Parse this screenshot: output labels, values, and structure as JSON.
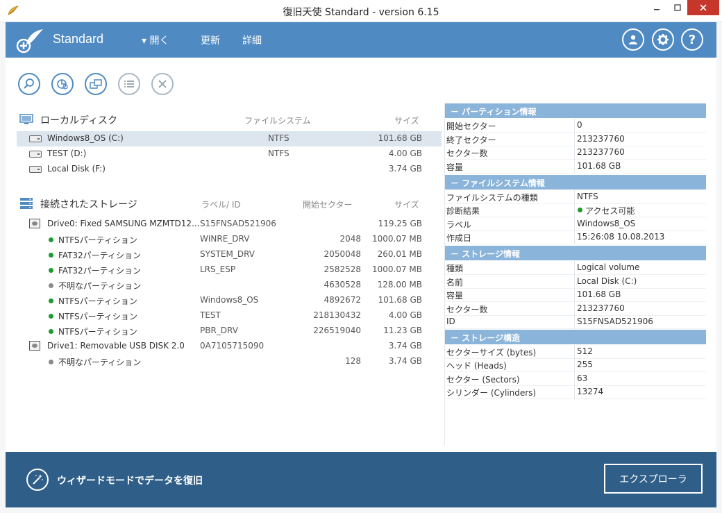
{
  "window": {
    "title": "復旧天使 Standard - version 6.15",
    "min_icon": "minimize-icon",
    "max_icon": "maximize-icon",
    "close_icon": "close-icon"
  },
  "header": {
    "brand": "Standard",
    "menu_open": "▾ 開く",
    "menu_refresh": "更新",
    "menu_detail": "詳細",
    "icons": [
      "user-icon",
      "gear-icon",
      "help-icon"
    ],
    "accent": "#4f8ac3"
  },
  "toolbar": {
    "icons": [
      "search-icon",
      "pie-chart-icon",
      "file-copy-icon",
      "list-icon",
      "close-icon"
    ]
  },
  "local": {
    "title": "ローカルディスク",
    "col_fs": "ファイルシステム",
    "col_size": "サイズ",
    "rows": [
      {
        "name": "Windows8_OS (C:)",
        "fs": "NTFS",
        "size": "101.68 GB"
      },
      {
        "name": "TEST (D:)",
        "fs": "NTFS",
        "size": "4.00 GB"
      },
      {
        "name": "Local Disk (F:)",
        "fs": "",
        "size": "3.74 GB"
      }
    ]
  },
  "storage": {
    "title": "接続されたストレージ",
    "col_label": "ラベル/ ID",
    "col_start": "開始セクター",
    "col_size": "サイズ",
    "rows": [
      {
        "type": "drive",
        "name": "Drive0: Fixed SAMSUNG MZMTD12...",
        "label": "S15FNSAD521906",
        "start": "",
        "size": "119.25 GB"
      },
      {
        "type": "part",
        "status": "green",
        "name": "NTFSパーティション",
        "label": "WINRE_DRV",
        "start": "2048",
        "size": "1000.07 MB"
      },
      {
        "type": "part",
        "status": "green",
        "name": "FAT32パーティション",
        "label": "SYSTEM_DRV",
        "start": "2050048",
        "size": "260.01 MB"
      },
      {
        "type": "part",
        "status": "green",
        "name": "FAT32パーティション",
        "label": "LRS_ESP",
        "start": "2582528",
        "size": "1000.07 MB"
      },
      {
        "type": "part",
        "status": "gray",
        "name": "不明なパーティション",
        "label": "",
        "start": "4630528",
        "size": "128.00 MB"
      },
      {
        "type": "part",
        "status": "green",
        "name": "NTFSパーティション",
        "label": "Windows8_OS",
        "start": "4892672",
        "size": "101.68 GB"
      },
      {
        "type": "part",
        "status": "green",
        "name": "NTFSパーティション",
        "label": "TEST",
        "start": "218130432",
        "size": "4.00 GB"
      },
      {
        "type": "part",
        "status": "green",
        "name": "NTFSパーティション",
        "label": "PBR_DRV",
        "start": "226519040",
        "size": "11.23 GB"
      },
      {
        "type": "drive",
        "name": "Drive1: Removable USB DISK 2.0",
        "label": "0A7105715090",
        "start": "",
        "size": "3.74 GB"
      },
      {
        "type": "part",
        "status": "gray",
        "name": "不明なパーティション",
        "label": "",
        "start": "128",
        "size": "3.74 GB"
      }
    ],
    "status_colors": {
      "green": "#1e9a2e",
      "gray": "#8a8a8a"
    }
  },
  "info": {
    "sections": [
      {
        "title": "－ パーティション情報",
        "rows": [
          {
            "k": "開始セクター",
            "v": "0"
          },
          {
            "k": "終了セクター",
            "v": "213237760"
          },
          {
            "k": "セクター数",
            "v": "213237760"
          },
          {
            "k": "容量",
            "v": "101.68 GB"
          }
        ]
      },
      {
        "title": "－ ファイルシステム情報",
        "rows": [
          {
            "k": "ファイルシステムの種類",
            "v": "NTFS"
          },
          {
            "k": "診断結果",
            "v": "アクセス可能",
            "dot": true
          },
          {
            "k": "ラベル",
            "v": "Windows8_OS"
          },
          {
            "k": "作成日",
            "v": "15:26:08 10.08.2013"
          }
        ]
      },
      {
        "title": "－ ストレージ情報",
        "rows": [
          {
            "k": "種類",
            "v": "Logical volume"
          },
          {
            "k": "名前",
            "v": "Local Disk (C:)"
          },
          {
            "k": "容量",
            "v": "101.68 GB"
          },
          {
            "k": "セクター数",
            "v": "213237760"
          },
          {
            "k": "ID",
            "v": "S15FNSAD521906"
          }
        ]
      },
      {
        "title": "－ ストレージ構造",
        "rows": [
          {
            "k": "セクターサイズ (bytes)",
            "v": "512"
          },
          {
            "k": "ヘッド (Heads)",
            "v": "255"
          },
          {
            "k": "セクター (Sectors)",
            "v": "63"
          },
          {
            "k": "シリンダー (Cylinders)",
            "v": "13274"
          }
        ]
      }
    ]
  },
  "footer": {
    "wizard": "ウィザードモードでデータを復旧",
    "explorer": "エクスプローラ",
    "wand_icon": "magic-wand-icon"
  }
}
